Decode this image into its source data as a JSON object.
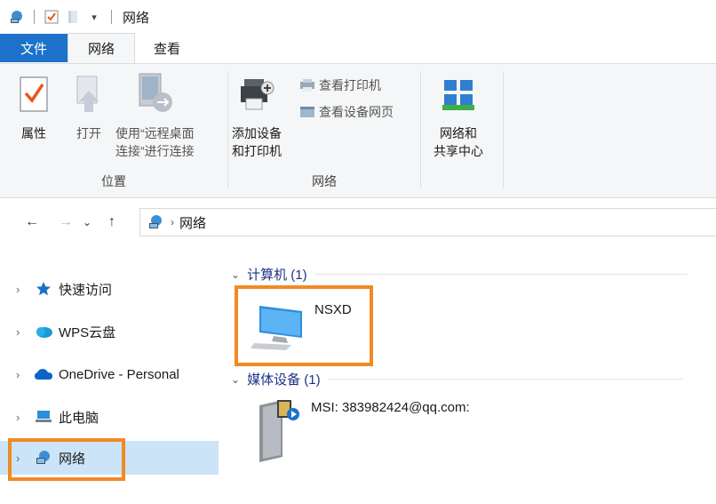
{
  "window": {
    "title": "网络"
  },
  "tabs": {
    "file": "文件",
    "network": "网络",
    "view": "查看"
  },
  "ribbon": {
    "location": {
      "group_label": "位置",
      "properties": "属性",
      "open": "打开",
      "remote_line1": "使用“远程桌面",
      "remote_line2": "连接”进行连接"
    },
    "network": {
      "group_label": "网络",
      "add_device_line1": "添加设备",
      "add_device_line2": "和打印机",
      "view_printers": "查看打印机",
      "view_device_webpage": "查看设备网页"
    },
    "sharing": {
      "line1": "网络和",
      "line2": "共享中心"
    }
  },
  "address": {
    "crumb": "网络"
  },
  "nav": {
    "quick_access": "快速访问",
    "wps_cloud": "WPS云盘",
    "onedrive": "OneDrive - Personal",
    "this_pc": "此电脑",
    "network": "网络"
  },
  "content": {
    "computers": {
      "header": "计算机 (1)",
      "items": [
        {
          "name": "NSXD"
        }
      ]
    },
    "media": {
      "header": "媒体设备 (1)",
      "items": [
        {
          "name": "MSI: 383982424@qq.com:"
        }
      ]
    }
  },
  "colors": {
    "accent": "#1c72c9",
    "highlight": "#f08a24",
    "selected": "#cce4f7",
    "group_header": "#1e3287"
  }
}
